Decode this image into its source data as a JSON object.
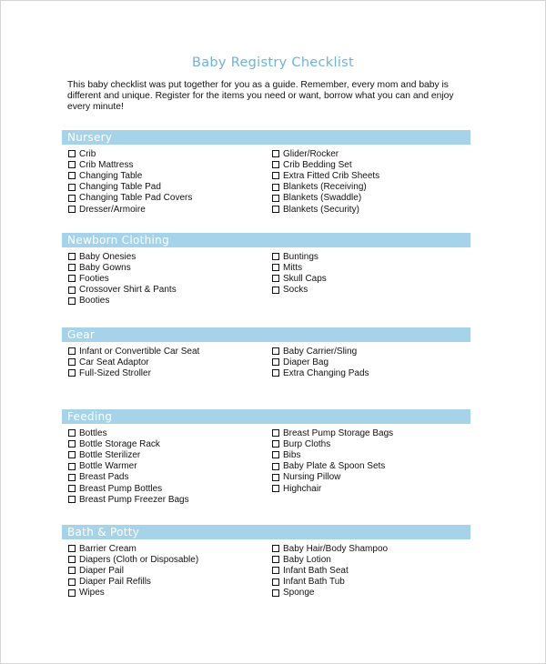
{
  "title": "Baby Registry Checklist",
  "intro": "This baby checklist was put together for you as a guide.  Remember, every mom and baby is different and unique.  Register for the items you need or want, borrow what you can and enjoy every minute!",
  "colors": {
    "title": "#6fb3d8",
    "section_header_bg": "#a6d3ea",
    "section_header_text": "#ffffff"
  },
  "sections": [
    {
      "title": "Nursery",
      "left": [
        "Crib",
        "Crib Mattress",
        "Changing Table",
        "Changing Table Pad",
        "Changing Table Pad Covers",
        "Dresser/Armoire"
      ],
      "right": [
        "Glider/Rocker",
        "Crib Bedding Set",
        "Extra Fitted Crib Sheets",
        "Blankets (Receiving)",
        "Blankets (Swaddle)",
        "Blankets (Security)"
      ]
    },
    {
      "title": "Newborn Clothing",
      "left": [
        "Baby Onesies",
        "Baby Gowns",
        "Footies",
        "Crossover Shirt & Pants",
        "Booties"
      ],
      "right": [
        "Buntings",
        "Mitts",
        "Skull Caps",
        "Socks"
      ]
    },
    {
      "title": "Gear",
      "left": [
        "Infant or Convertible Car Seat",
        "Car Seat Adaptor",
        "Full-Sized Stroller"
      ],
      "right": [
        "Baby Carrier/Sling",
        "Diaper Bag",
        "Extra Changing Pads"
      ]
    },
    {
      "title": "Feeding",
      "left": [
        "Bottles",
        "Bottle Storage Rack",
        "Bottle Sterilizer",
        "Bottle Warmer",
        "Breast Pads",
        "Breast Pump Bottles",
        "Breast Pump Freezer Bags"
      ],
      "right": [
        "Breast Pump Storage Bags",
        "Burp Cloths",
        "Bibs",
        "Baby Plate & Spoon Sets",
        "Nursing Pillow",
        "Highchair"
      ]
    },
    {
      "title": "Bath & Potty",
      "left": [
        "Barrier Cream",
        "Diapers (Cloth or Disposable)",
        "Diaper Pail",
        "Diaper Pail Refills",
        "Wipes"
      ],
      "right": [
        "Baby Hair/Body Shampoo",
        "Baby Lotion",
        "Infant Bath Seat",
        "Infant Bath Tub",
        "Sponge"
      ]
    }
  ]
}
